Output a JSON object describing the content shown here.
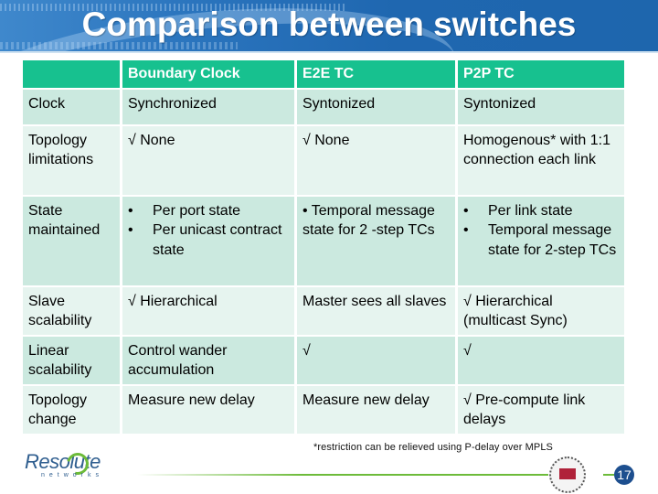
{
  "slide": {
    "title": "Comparison between switches",
    "footnote": "*restriction can be relieved using P-delay over MPLS",
    "page_number": "17",
    "logo": {
      "name": "Resolute",
      "subtitle": "networks"
    },
    "colors": {
      "banner": "#1f67b0",
      "header": "#17c18f",
      "row_odd": "#cbe9df",
      "row_even": "#e6f4ef",
      "page_badge": "#1d4f8f",
      "rule": "#6dbb3a"
    }
  },
  "table": {
    "headers": [
      "",
      "Boundary Clock",
      "E2E TC",
      "P2P TC"
    ],
    "rows": [
      {
        "label": "Clock",
        "cells": [
          "Synchronized",
          "Syntonized",
          "Syntonized"
        ]
      },
      {
        "label": "Topology limitations",
        "cells": [
          "√ None",
          "√ None",
          "Homogenous* with 1:1 connection each link"
        ]
      },
      {
        "label": "State maintained",
        "bc_bullets": [
          "Per port state",
          "Per unicast contract state"
        ],
        "e2e": "• Temporal message state for 2 -step TCs",
        "p2p_bullets": [
          "Per link state",
          "Temporal message state for 2-step TCs"
        ],
        "bullet": "•"
      },
      {
        "label": "Slave scalability",
        "cells": [
          "√ Hierarchical",
          "Master sees all slaves",
          "√ Hierarchical (multicast Sync)"
        ]
      },
      {
        "label": "Linear scalability",
        "cells": [
          "Control wander accumulation",
          "√",
          "√"
        ]
      },
      {
        "label": "Topology change",
        "cells": [
          "Measure new delay",
          "Measure new delay",
          "√ Pre-compute link delays"
        ]
      }
    ]
  }
}
